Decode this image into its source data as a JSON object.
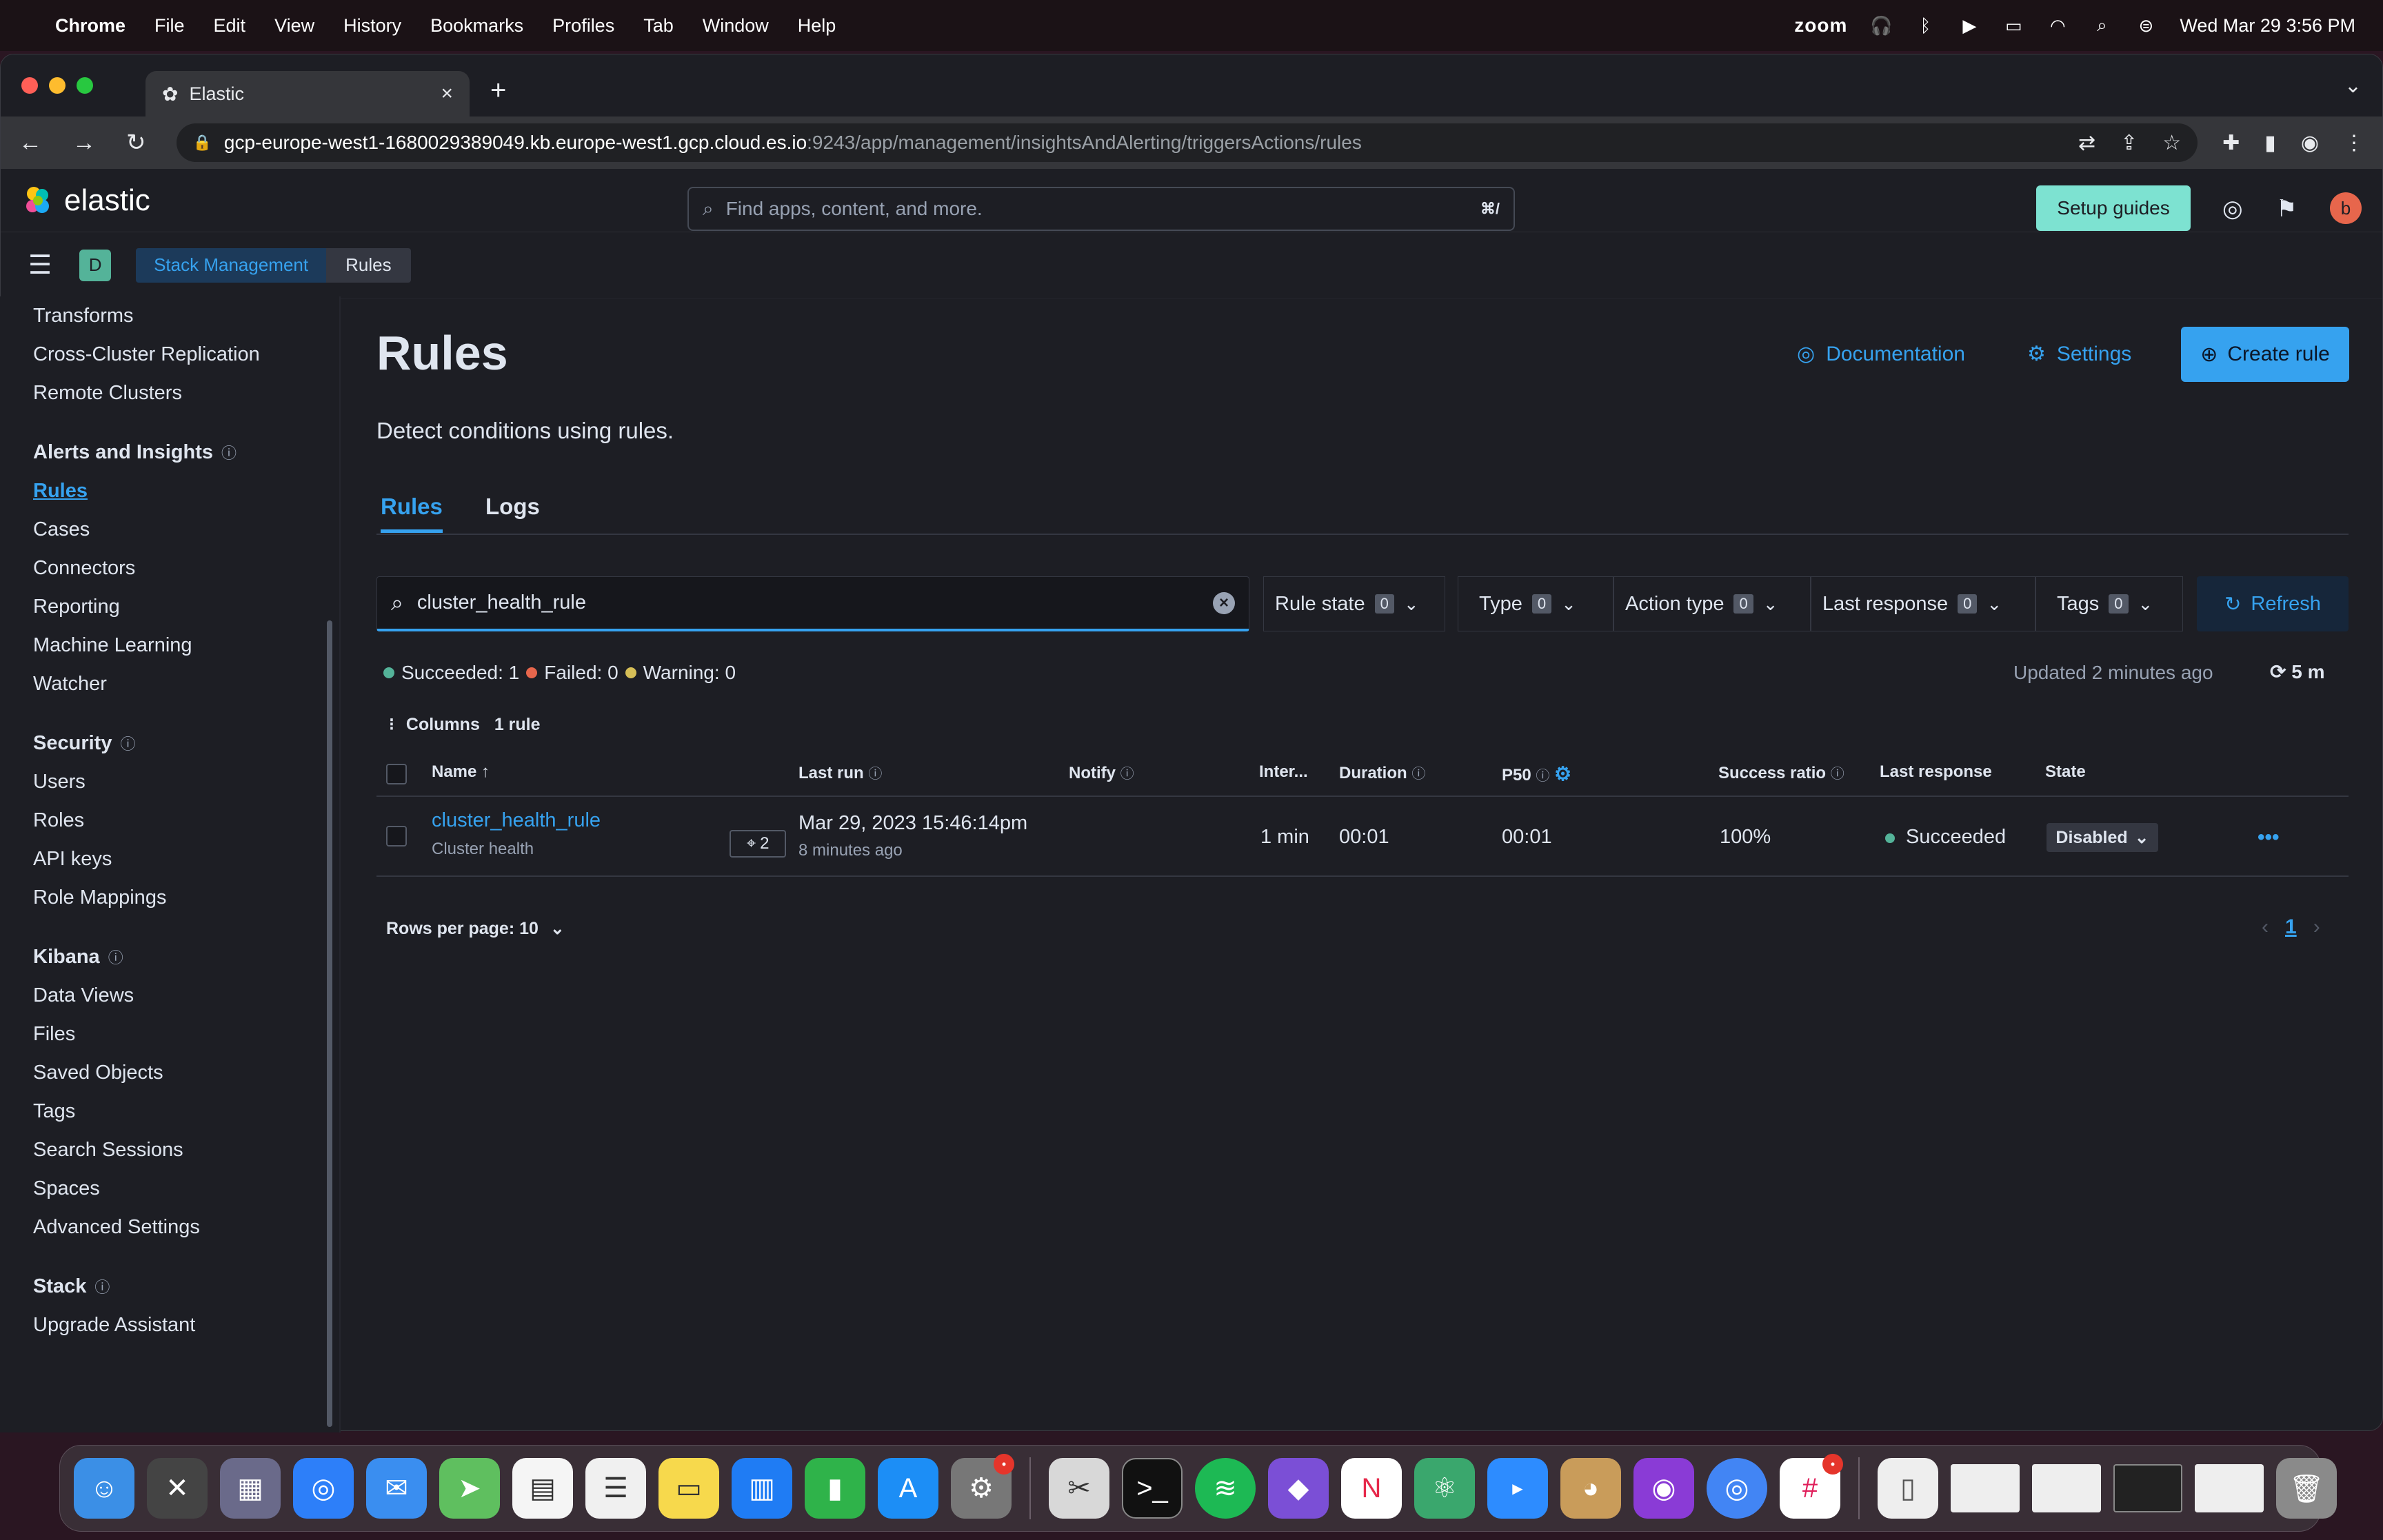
{
  "menubar": {
    "app": "Chrome",
    "items": [
      "File",
      "Edit",
      "View",
      "History",
      "Bookmarks",
      "Profiles",
      "Tab",
      "Window",
      "Help"
    ],
    "zoom": "zoom",
    "datetime": "Wed Mar 29  3:56 PM"
  },
  "browser": {
    "tab_title": "Elastic",
    "url_host": "gcp-europe-west1-1680029389049.kb.europe-west1.gcp.cloud.es.io",
    "url_path": ":9243/app/management/insightsAndAlerting/triggersActions/rules"
  },
  "header": {
    "logo": "elastic",
    "search_placeholder": "Find apps, content, and more.",
    "shortcut": "⌘/",
    "setup_guides": "Setup guides",
    "avatar": "b"
  },
  "breadcrumb": {
    "space": "D",
    "items": [
      "Stack Management",
      "Rules"
    ]
  },
  "sidebar": {
    "top_items": [
      "Transforms",
      "Cross-Cluster Replication",
      "Remote Clusters"
    ],
    "sections": [
      {
        "title": "Alerts and Insights",
        "items": [
          "Rules",
          "Cases",
          "Connectors",
          "Reporting",
          "Machine Learning",
          "Watcher"
        ]
      },
      {
        "title": "Security",
        "items": [
          "Users",
          "Roles",
          "API keys",
          "Role Mappings"
        ]
      },
      {
        "title": "Kibana",
        "items": [
          "Data Views",
          "Files",
          "Saved Objects",
          "Tags",
          "Search Sessions",
          "Spaces",
          "Advanced Settings"
        ]
      },
      {
        "title": "Stack",
        "items": [
          "Upgrade Assistant"
        ]
      }
    ]
  },
  "page": {
    "title": "Rules",
    "description": "Detect conditions using rules.",
    "documentation": "Documentation",
    "settings": "Settings",
    "create_rule": "Create rule"
  },
  "tabs": [
    "Rules",
    "Logs"
  ],
  "filters": {
    "search_value": "cluster_health_rule",
    "buttons": [
      {
        "label": "Rule state",
        "count": "0"
      },
      {
        "label": "Type",
        "count": "0"
      },
      {
        "label": "Action type",
        "count": "0"
      },
      {
        "label": "Last response",
        "count": "0"
      },
      {
        "label": "Tags",
        "count": "0"
      }
    ],
    "refresh": "Refresh"
  },
  "status": {
    "succeeded": "Succeeded: 1",
    "failed": "Failed: 0",
    "warning": "Warning: 0",
    "updated": "Updated 2 minutes ago",
    "interval": "5 m"
  },
  "columns_row": {
    "columns": "Columns",
    "count": "1 rule"
  },
  "table": {
    "headers": [
      "Name",
      "Last run",
      "Notify",
      "Inter...",
      "Duration",
      "P50",
      "Success ratio",
      "Last response",
      "State"
    ],
    "row": {
      "name": "cluster_health_rule",
      "type": "Cluster health",
      "tags": "2",
      "last_run": "Mar 29, 2023 15:46:14pm",
      "last_run_ago": "8 minutes ago",
      "interval": "1 min",
      "duration": "00:01",
      "p50": "00:01",
      "success_ratio": "100%",
      "last_response": "Succeeded",
      "state": "Disabled"
    }
  },
  "pagination": {
    "rows_per_page": "Rows per page: 10",
    "page": "1"
  },
  "colors": {
    "accent": "#36a2ef",
    "success": "#54b399",
    "danger": "#e7664c",
    "warning": "#d6bf57"
  }
}
